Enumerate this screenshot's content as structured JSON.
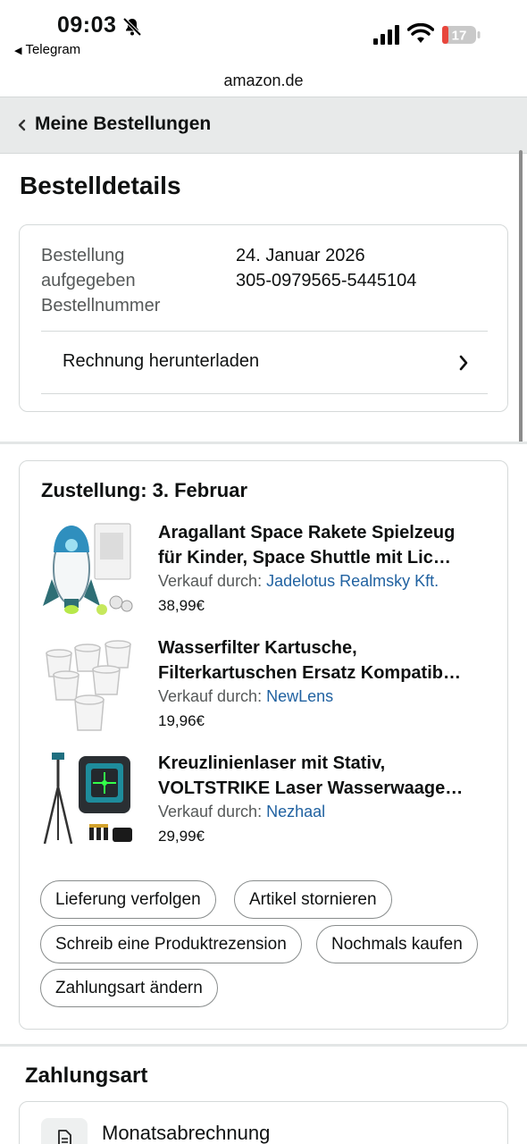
{
  "status_bar": {
    "time": "09:03",
    "back_app": "Telegram",
    "battery": "17",
    "battery_color": "#e8463c"
  },
  "url": "amazon.de",
  "breadcrumb": {
    "label": "Meine Bestellungen"
  },
  "page_title": "Bestelldetails",
  "order_info": {
    "label_placed_line1": "Bestellung",
    "label_placed_line2": "aufgegeben",
    "label_number": "Bestellnummer",
    "date": "24. Januar 2026",
    "number": "305-0979565-5445104",
    "invoice_label": "Rechnung herunterladen"
  },
  "shipment": {
    "heading": "Zustellung: 3. Februar",
    "items": [
      {
        "title_line1": "Aragallant Space Rakete Spielzeug",
        "title_line2": "für Kinder, Space Shuttle mit Lic…",
        "seller_label": "Verkauf durch:",
        "seller": "Jadelotus Realmsky Kft.",
        "price": "38,99€"
      },
      {
        "title_line1": "Wasserfilter Kartusche,",
        "title_line2": "Filterkartuschen Ersatz Kompatib…",
        "seller_label": "Verkauf durch:",
        "seller": "NewLens",
        "price": "19,96€"
      },
      {
        "title_line1": "Kreuzlinienlaser mit Stativ,",
        "title_line2": "VOLTSTRIKE Laser Wasserwaage…",
        "seller_label": "Verkauf durch:",
        "seller": "Nezhaal",
        "price": "29,99€"
      }
    ],
    "actions": {
      "track": "Lieferung verfolgen",
      "cancel": "Artikel stornieren",
      "review": "Schreib eine Produktrezension",
      "buy_again": "Nochmals kaufen",
      "change_payment": "Zahlungsart ändern"
    }
  },
  "payment": {
    "heading": "Zahlungsart",
    "method": "Monatsabrechnung"
  },
  "colors": {
    "link": "#2162a1",
    "muted": "#565959",
    "breadcrumb_bg": "#e8eaea",
    "border": "#d5d9d9"
  }
}
